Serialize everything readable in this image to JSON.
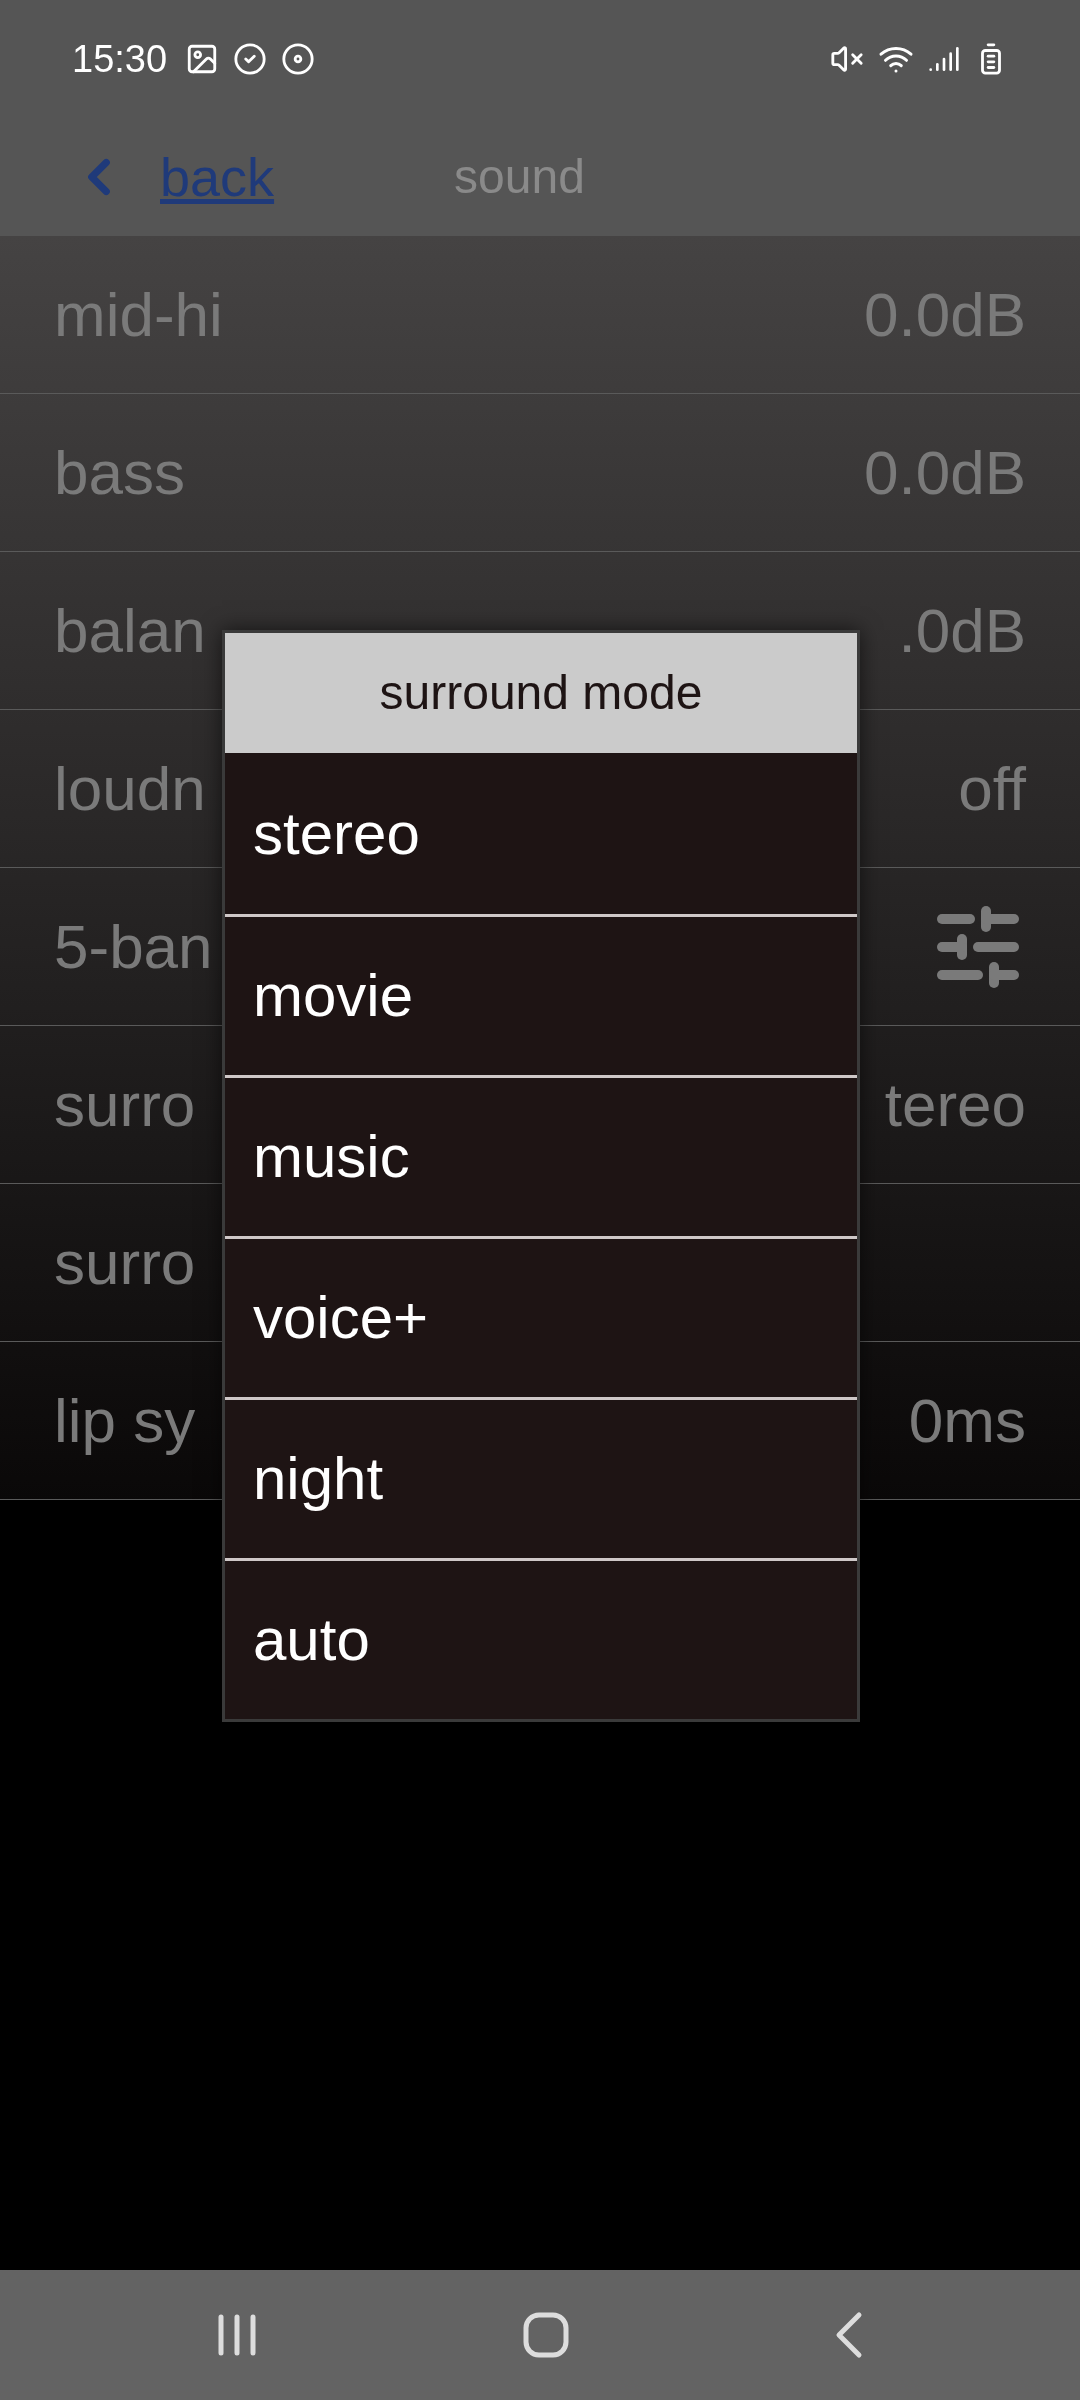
{
  "status_bar": {
    "time": "15:30"
  },
  "header": {
    "back_label": "back",
    "title": "sound"
  },
  "rows": [
    {
      "label": "mid-hi",
      "kind": "value",
      "value": "0.0dB"
    },
    {
      "label": "bass",
      "kind": "value",
      "value": "0.0dB"
    },
    {
      "label": "balan",
      "kind": "value",
      "value": ".0dB"
    },
    {
      "label": "loudn",
      "kind": "value",
      "value": "off"
    },
    {
      "label": "5-ban",
      "kind": "icon"
    },
    {
      "label": "surro",
      "kind": "value",
      "value": "tereo"
    },
    {
      "label": "surro",
      "kind": "none"
    },
    {
      "label": "lip sy",
      "kind": "value",
      "value": "0ms"
    }
  ],
  "dialog": {
    "title": "surround mode",
    "options": [
      "stereo",
      "movie",
      "music",
      "voice+",
      "night",
      "auto"
    ]
  }
}
